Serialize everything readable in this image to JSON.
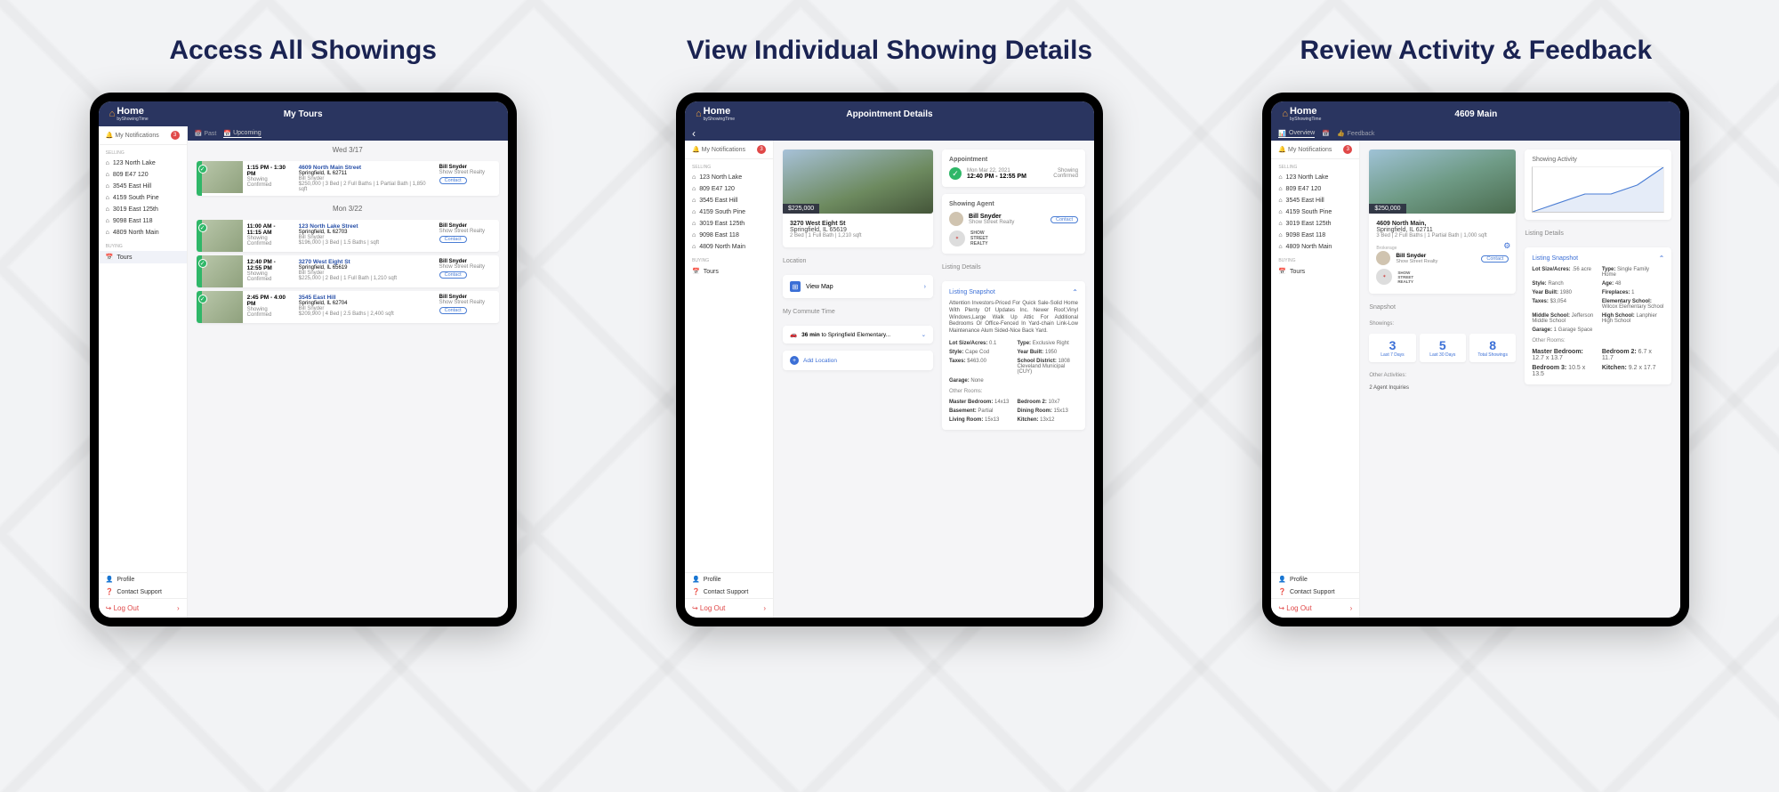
{
  "app": {
    "logo": "Home",
    "logo_sub": "byShowingTime",
    "notifications_label": "My Notifications",
    "notifications_count": "3",
    "sidebar": {
      "selling_label": "SELLING",
      "buying_label": "BUYING",
      "items": [
        {
          "label": "123 North Lake"
        },
        {
          "label": "809 E47 120"
        },
        {
          "label": "3545 East Hill"
        },
        {
          "label": "4159 South Pine"
        },
        {
          "label": "3019 East 125th"
        },
        {
          "label": "9098 East 118"
        },
        {
          "label": "4809 North Main"
        }
      ],
      "tours_label": "Tours",
      "profile_label": "Profile",
      "support_label": "Contact Support",
      "logout_label": "Log Out"
    }
  },
  "panel1": {
    "title": "Access All Showings",
    "header": "My Tours",
    "tabs": {
      "past": "Past",
      "upcoming": "Upcoming"
    },
    "groups": [
      {
        "date": "Wed 3/17",
        "tours": [
          {
            "time": "1:15 PM - 1:30 PM",
            "status_line1": "Showing",
            "status_line2": "Confirmed",
            "street": "4609 North Main Street",
            "city": "Springfield, IL 62711",
            "broker": "Bill Snyder",
            "price_meta": "$250,000 | 3 Bed | 2 Full Baths | 1 Partial Bath | 1,850 sqft",
            "agent": "Bill Snyder",
            "brokerage": "Show Street Realty"
          }
        ]
      },
      {
        "date": "Mon 3/22",
        "tours": [
          {
            "time": "11:00 AM - 11:15 AM",
            "status_line1": "Showing",
            "status_line2": "Confirmed",
            "street": "123 North Lake Street",
            "city": "Springfield, IL 62703",
            "broker": "Bill Snyder",
            "price_meta": "$196,000 | 3 Bed | 1.5 Baths | sqft",
            "agent": "Bill Snyder",
            "brokerage": "Show Street Realty"
          },
          {
            "time": "12:40 PM - 12:55 PM",
            "status_line1": "Showing",
            "status_line2": "Confirmed",
            "street": "3270 West Eight St",
            "city": "Springfield, IL 65619",
            "broker": "Bill Snyder",
            "price_meta": "$225,000 | 2 Bed | 1 Full Bath | 1,210 sqft",
            "agent": "Bill Snyder",
            "brokerage": "Show Street Realty"
          },
          {
            "time": "2:45 PM - 4:00 PM",
            "status_line1": "Showing",
            "status_line2": "Confirmed",
            "street": "3545 East Hill",
            "city": "Springfield, IL 62704",
            "broker": "Bill Snyder",
            "price_meta": "$209,900 | 4 Bed | 2.5 Baths | 2,400 sqft",
            "agent": "Bill Snyder",
            "brokerage": "Show Street Realty"
          }
        ]
      }
    ]
  },
  "panel2": {
    "title": "View Individual Showing Details",
    "header": "Appointment Details",
    "price": "$225,000",
    "street": "3270 West Eight St",
    "city": "Springfield, IL 65619",
    "meta": "2 Bed | 1 Full Bath | 1,210 sqft",
    "location_label": "Location",
    "view_map": "View Map",
    "commute_label": "My Commute Time",
    "commute_time": "36 min",
    "commute_dest": "to Springfield Elementary...",
    "add_location": "Add Location",
    "appointment": {
      "label": "Appointment",
      "date": "Mon Mar 22, 2021",
      "time": "12:40 PM - 12:55 PM",
      "status1": "Showing",
      "status2": "Confirmed"
    },
    "agent_label": "Showing Agent",
    "agent": {
      "name": "Bill Snyder",
      "brokerage": "Show Street Realty",
      "contact": "Contact"
    },
    "listing_details_label": "Listing Details",
    "snapshot": {
      "title": "Listing Snapshot",
      "desc": "Attention Investors-Priced For Quick Sale-Solid Home With Plenty Of Updates Inc. Newer Roof,Vinyl Windows,Large Walk Up Attic For Additional Bedrooms Or Office-Fenced In Yard-chain Link-Low Maintenance Alum Sided-Nice Back Yard.",
      "kv": [
        {
          "k": "Lot Size/Acres:",
          "v": "0.1"
        },
        {
          "k": "Type:",
          "v": "Exclusive Right"
        },
        {
          "k": "Style:",
          "v": "Cape Cod"
        },
        {
          "k": "Year Built:",
          "v": "1950"
        },
        {
          "k": "Taxes:",
          "v": "$463.00"
        },
        {
          "k": "School District:",
          "v": "1808 Cleveland Municipal (CUY)"
        },
        {
          "k": "Garage:",
          "v": "None"
        }
      ],
      "rooms_label": "Other Rooms:",
      "rooms": [
        {
          "k": "Master Bedroom:",
          "v": "14x13"
        },
        {
          "k": "Bedroom 2:",
          "v": "10x7"
        },
        {
          "k": "Basement:",
          "v": "Partial"
        },
        {
          "k": "Dining Room:",
          "v": "15x13"
        },
        {
          "k": "Living Room:",
          "v": "15x13"
        },
        {
          "k": "Kitchen:",
          "v": "13x12"
        }
      ]
    }
  },
  "panel3": {
    "title": "Review Activity & Feedback",
    "header": "4609 Main",
    "tabs": {
      "overview": "Overview",
      "feedback": "Feedback",
      "another": ""
    },
    "price": "$250,000",
    "street": "4609 North Main,",
    "city": "Springfield, IL 62711",
    "meta": "3 Bed | 2 Full Baths | 1 Partial Bath | 1,000 sqft",
    "brokerage_label": "Brokerage",
    "agent": {
      "name": "Bill Snyder",
      "brokerage": "Show Street Realty",
      "contact": "Contact"
    },
    "snapshot_label": "Snapshot",
    "showings_label": "Showings:",
    "stats": [
      {
        "num": "3",
        "lbl": "Last 7 Days"
      },
      {
        "num": "5",
        "lbl": "Last 30 Days"
      },
      {
        "num": "8",
        "lbl": "Total Showings"
      }
    ],
    "other_activities_label": "Other Activities:",
    "other_activities": "2 Agent Inquiries",
    "activity_chart_label": "Showing Activity",
    "listing_details_label": "Listing Details",
    "listing_snapshot_title": "Listing Snapshot",
    "kv": [
      {
        "k": "Lot Size/Acres:",
        "v": ".56 acre"
      },
      {
        "k": "Type:",
        "v": "Single Family Home"
      },
      {
        "k": "Style:",
        "v": "Ranch"
      },
      {
        "k": "Age:",
        "v": "48"
      },
      {
        "k": "Year Built:",
        "v": "1980"
      },
      {
        "k": "Fireplaces:",
        "v": "1"
      },
      {
        "k": "Taxes:",
        "v": "$3,054"
      },
      {
        "k": "Elementary School:",
        "v": "Wilcox Elementary School"
      },
      {
        "k": "Middle School:",
        "v": "Jefferson Middle School"
      },
      {
        "k": "High School:",
        "v": "Lanphier High School"
      },
      {
        "k": "Garage:",
        "v": "1 Garage Space"
      }
    ],
    "rooms_label": "Other Rooms:",
    "rooms": [
      {
        "k": "Master Bedroom:",
        "v": "12.7 x 13.7"
      },
      {
        "k": "Bedroom 2:",
        "v": "6.7 x 11.7"
      },
      {
        "k": "Bedroom 3:",
        "v": "10.5 x 13.5"
      },
      {
        "k": "Kitchen:",
        "v": "9.2 x 17.7"
      }
    ]
  },
  "chart_data": {
    "type": "line",
    "title": "Showing Activity",
    "x": [
      0,
      1,
      2,
      3,
      4,
      5
    ],
    "values": [
      0,
      1,
      2,
      2,
      3,
      5
    ],
    "ylim": [
      0,
      5
    ]
  },
  "common": {
    "contact": "Contact"
  }
}
